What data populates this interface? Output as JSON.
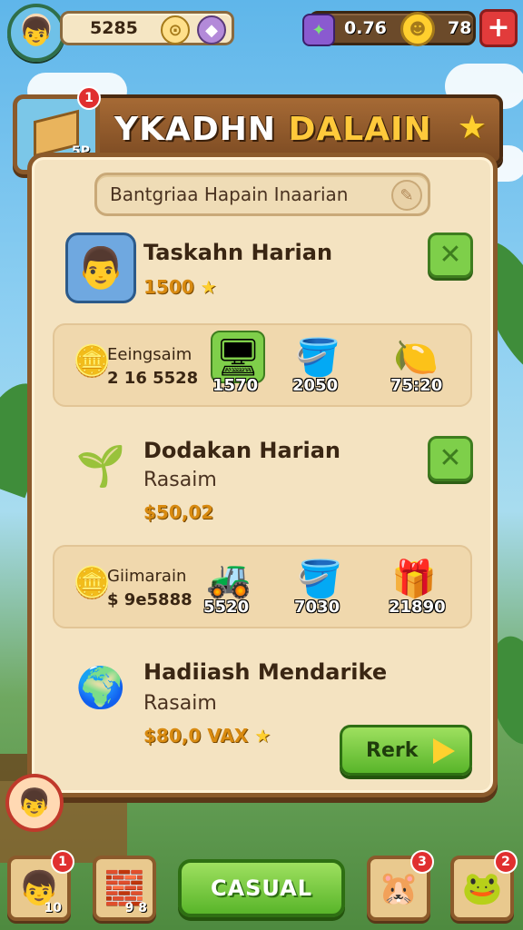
{
  "header": {
    "stat_1": "5285",
    "stat_2": "0.76",
    "coins": "78",
    "plus_label": "+"
  },
  "badge": {
    "notification": "1",
    "level": "5P"
  },
  "title": {
    "part_1": "YKADHN",
    "part_2": "DALAIN"
  },
  "search": {
    "text": "Bantgriaa Hapain Inaarian"
  },
  "tasks": [
    {
      "title": "Taskahn Harian",
      "reward": "1500"
    },
    {
      "title": "Dodakan Harian",
      "subtitle": "Rasaim",
      "reward": "$50,02"
    },
    {
      "title": "Hadiiash Mendarike",
      "subtitle": "Rasaim",
      "reward": "$80,0 VAX"
    }
  ],
  "reward_rows": [
    {
      "label": "Eeingsaim",
      "value": "2 16 5528",
      "items": [
        "1570",
        "2050",
        "75:20"
      ]
    },
    {
      "label": "Giimarain",
      "value": "$ 9e5888",
      "items": [
        "5520",
        "7030",
        "21890"
      ]
    }
  ],
  "claim_button": "Rerk",
  "bottom": {
    "slot_1_badge": "1",
    "slot_1_caption": "10",
    "slot_2_caption": "9 8",
    "main_button": "CASUAL",
    "slot_3_badge": "3",
    "slot_4_badge": "2"
  },
  "icons": {
    "header_stat_1": "pin-icon",
    "header_stat_2": "gem-icon",
    "currency": "gift-icon",
    "coin": "coin-icon",
    "close": "x-icon",
    "title_star": "star-icon",
    "search_action": "pencil-icon"
  },
  "colors": {
    "panel": "#f4e3c1",
    "wood": "#8b5a2b",
    "green_button": "#59b52a",
    "gold_text": "#ffc93b",
    "notification_red": "#e02f2f"
  }
}
